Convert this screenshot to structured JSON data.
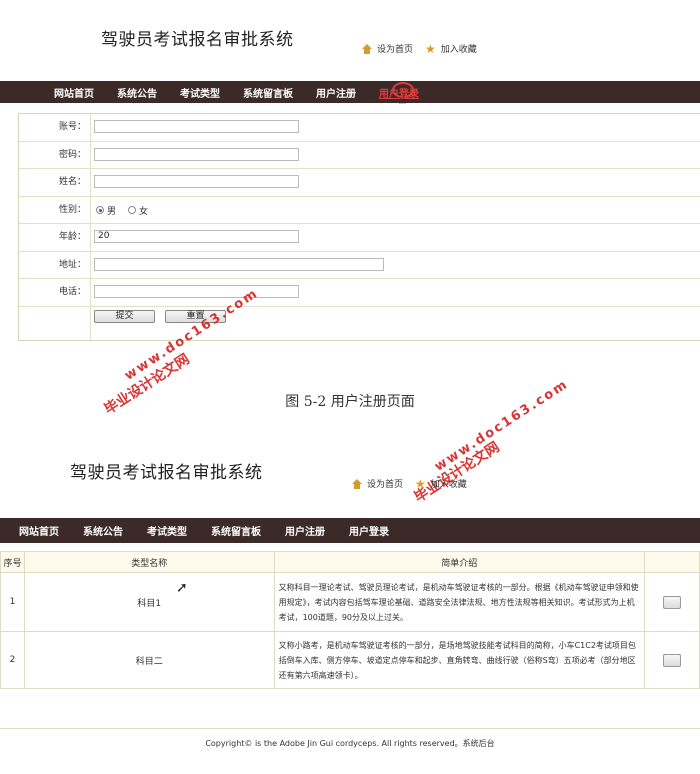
{
  "screen1": {
    "site_title": "驾驶员考试报名审批系统",
    "set_home": "设为首页",
    "add_favorite": "加入收藏",
    "nav": [
      "网站首页",
      "系统公告",
      "考试类型",
      "系统留言板",
      "用户注册",
      "用户登录"
    ],
    "active_nav": "用户登录",
    "form": {
      "account_label": "账号：",
      "account_value": "",
      "password_label": "密码：",
      "password_value": "",
      "name_label": "姓名：",
      "name_value": "",
      "gender_label": "性别：",
      "gender_options": [
        "男",
        "女"
      ],
      "gender_selected": "男",
      "age_label": "年龄：",
      "age_value": "20",
      "address_label": "地址：",
      "address_value": "",
      "phone_label": "电话：",
      "phone_value": "",
      "submit_label": "提交",
      "reset_label": "重置"
    }
  },
  "caption": "图 5-2 用户注册页面",
  "watermarks": [
    {
      "line1": "毕业设计论文网",
      "line2": "www.doc163.com"
    },
    {
      "line1": "毕业设计论文网",
      "line2": "www.doc163.com"
    }
  ],
  "screen2": {
    "site_title": "驾驶员考试报名审批系统",
    "set_home": "设为首页",
    "add_favorite": "加入收藏",
    "nav": [
      "网站首页",
      "系统公告",
      "考试类型",
      "系统留言板",
      "用户注册",
      "用户登录"
    ],
    "table": {
      "headers": [
        "序号",
        "类型名称",
        "简单介绍"
      ],
      "rows": [
        {
          "no": "1",
          "name": "科目1",
          "desc": "又称科目一理论考试、驾驶员理论考试，是机动车驾驶证考核的一部分。根据《机动车驾驶证申领和使用规定》，考试内容包括驾车理论基础、道路安全法律法规、地方性法规等相关知识。考试形式为上机考试，100道题，90分及以上过关。"
        },
        {
          "no": "2",
          "name": "科目二",
          "desc": "又称小路考，是机动车驾驶证考核的一部分，是场地驾驶技能考试科目的简称，小车C1C2考试项目包括倒车入库、侧方停车、坡道定点停车和起步、直角转弯、曲线行驶（俗称S弯）五项必考（部分地区还有第六项高速领卡）。"
        }
      ]
    },
    "footer": "Copyright© is the Adobe Jin Gui cordyceps. All rights reserved。系统后台"
  }
}
